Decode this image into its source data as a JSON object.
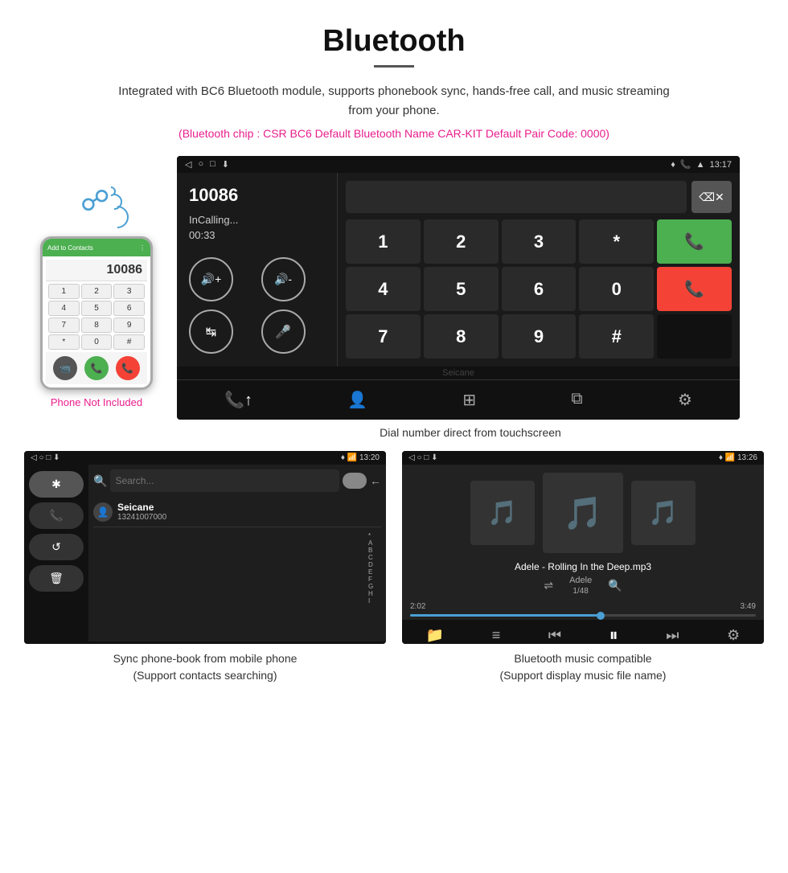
{
  "header": {
    "title": "Bluetooth",
    "description": "Integrated with BC6 Bluetooth module, supports phonebook sync, hands-free call, and music streaming from your phone.",
    "specs": "(Bluetooth chip : CSR BC6    Default Bluetooth Name CAR-KIT    Default Pair Code: 0000)"
  },
  "phone_side": {
    "not_included": "Phone Not Included"
  },
  "main_screen": {
    "status_bar": {
      "nav_back": "◁",
      "nav_home": "○",
      "nav_recent": "□",
      "nav_download": "⬇",
      "location": "📍",
      "signal": "📶",
      "time": "13:17"
    },
    "dialer": {
      "number": "10086",
      "status": "InCalling...",
      "timer": "00:33",
      "volume_up": "🔊+",
      "volume_down": "🔊-",
      "transfer": "↹",
      "mic": "🎤",
      "keypad": [
        "1",
        "2",
        "3",
        "*",
        "4",
        "5",
        "6",
        "0",
        "7",
        "8",
        "9",
        "#"
      ]
    }
  },
  "main_caption": "Dial number direct from touchscreen",
  "phonebook_screen": {
    "status_time": "13:20",
    "contact_name": "Seicane",
    "contact_number": "13241007000",
    "alpha_list": [
      "*",
      "A",
      "B",
      "C",
      "D",
      "E",
      "F",
      "G",
      "H",
      "I"
    ]
  },
  "music_screen": {
    "status_time": "13:26",
    "song_name": "Adele - Rolling In the Deep.mp3",
    "artist": "Adele",
    "count": "1/48",
    "time_current": "2:02",
    "time_total": "3:49",
    "progress_percent": 55
  },
  "bottom_captions": {
    "phonebook": "Sync phone-book from mobile phone\n(Support contacts searching)",
    "music": "Bluetooth music compatible\n(Support display music file name)"
  },
  "icons": {
    "bluetooth": "✱",
    "phone_call": "📞",
    "contacts": "👤",
    "grid": "⊞",
    "transfer_screen": "⧉",
    "settings": "⚙",
    "shuffle": "⇌",
    "search": "🔍",
    "folder": "📁",
    "list": "≡",
    "prev": "⏮",
    "play": "⏵",
    "pause": "⏸",
    "next": "⏭",
    "equalizer": "⚙"
  }
}
